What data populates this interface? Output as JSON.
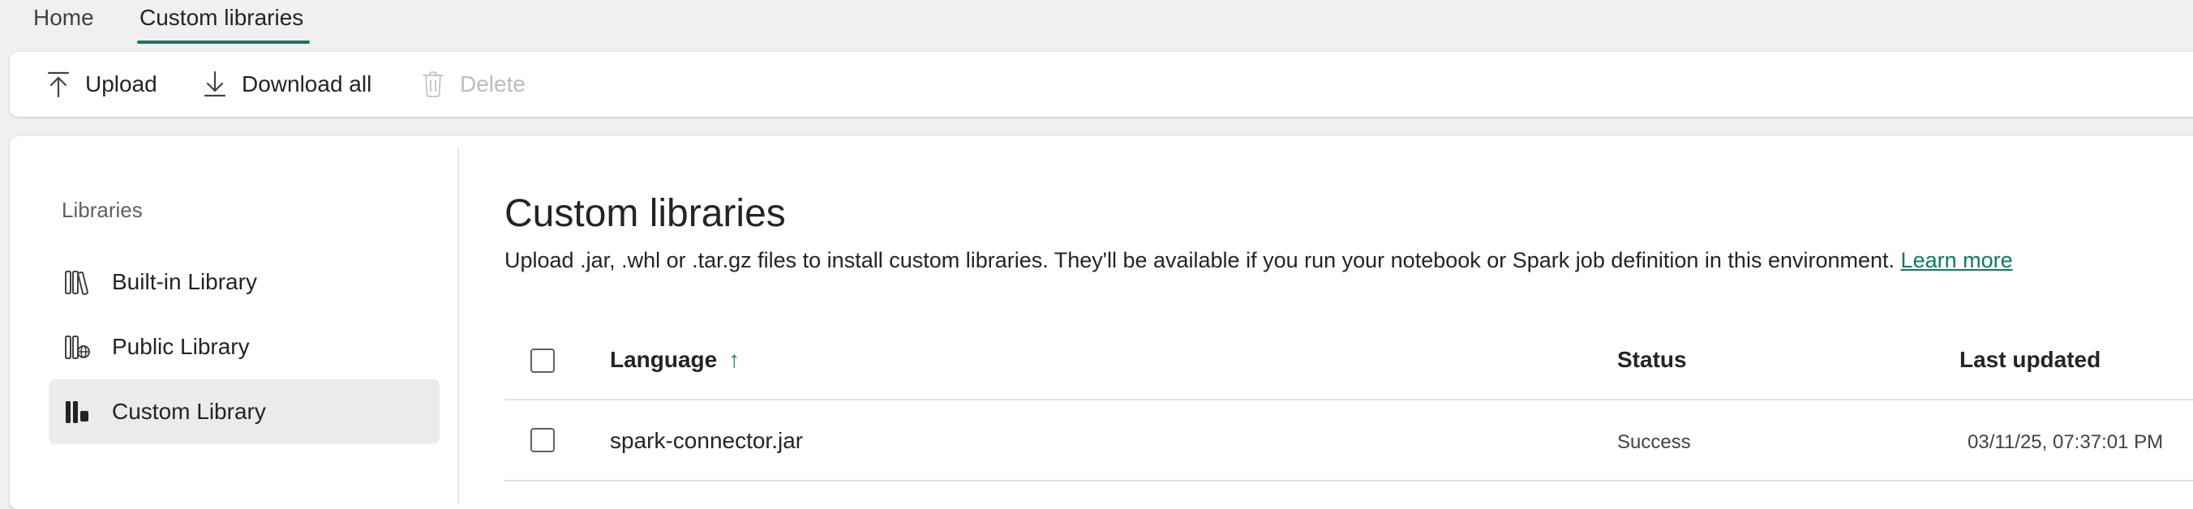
{
  "tabs": [
    {
      "label": "Home"
    },
    {
      "label": "Custom libraries"
    }
  ],
  "toolbar": {
    "upload_label": "Upload",
    "download_label": "Download all",
    "delete_label": "Delete"
  },
  "sidebar": {
    "heading": "Libraries",
    "items": [
      {
        "label": "Built-in Library",
        "icon": "books-icon"
      },
      {
        "label": "Public Library",
        "icon": "public-books-icon"
      },
      {
        "label": "Custom Library",
        "icon": "custom-books-icon",
        "active": true
      }
    ]
  },
  "main": {
    "title": "Custom libraries",
    "description": "Upload .jar, .whl or .tar.gz files to install custom libraries. They'll be available if you run your notebook or Spark job definition in this environment.",
    "learn_more": "Learn more"
  },
  "table": {
    "columns": [
      "Language",
      "Status",
      "Last updated"
    ],
    "sort_indicator": "↑",
    "rows": [
      {
        "name": "spark-connector.jar",
        "status": "Success",
        "updated": "03/11/25, 07:37:01 PM"
      }
    ]
  },
  "colors": {
    "accent": "#117865",
    "background": "#f0f0f0",
    "panel": "#ffffff",
    "active_item": "#ebebeb"
  }
}
